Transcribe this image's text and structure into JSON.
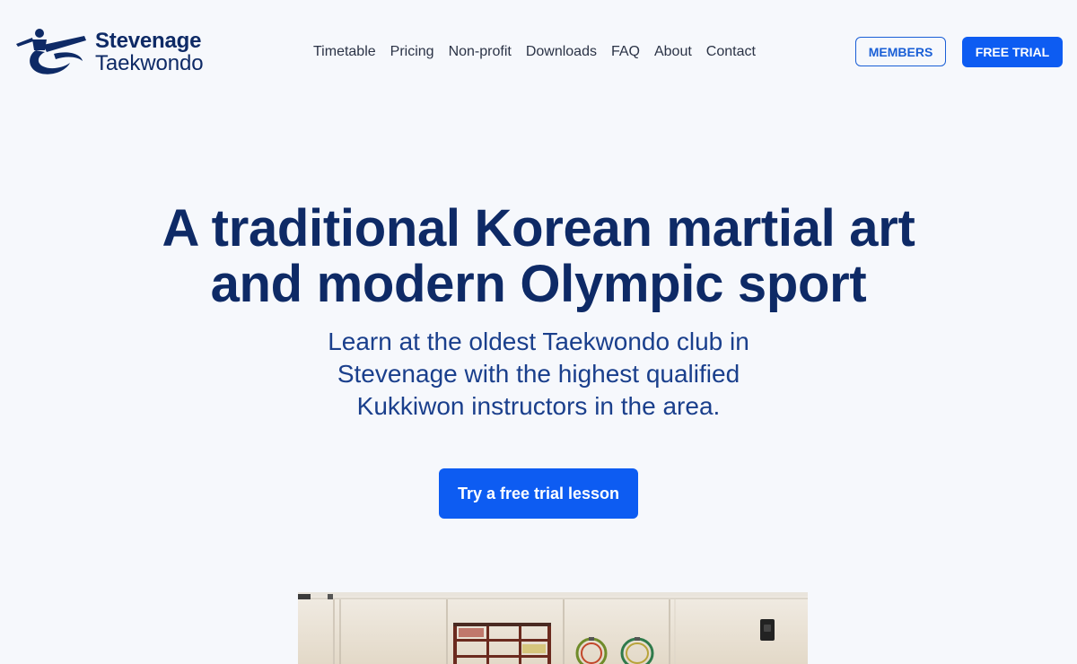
{
  "brand": {
    "line1": "Stevenage",
    "line2": "Taekwondo"
  },
  "nav": [
    {
      "label": "Timetable"
    },
    {
      "label": "Pricing"
    },
    {
      "label": "Non-profit"
    },
    {
      "label": "Downloads"
    },
    {
      "label": "FAQ"
    },
    {
      "label": "About"
    },
    {
      "label": "Contact"
    }
  ],
  "header_buttons": {
    "members": "MEMBERS",
    "free_trial": "FREE TRIAL"
  },
  "hero": {
    "title_line1": "A traditional Korean martial art",
    "title_line2": "and modern Olympic sport",
    "sub_line1": "Learn at the oldest Taekwondo club in",
    "sub_line2": "Stevenage with the highest qualified",
    "sub_line3": "Kukkiwon instructors in the area.",
    "cta": "Try a free trial lesson"
  },
  "colors": {
    "brand_navy": "#0e2a66",
    "accent_blue": "#0d5cf2",
    "background": "#f6f8fc"
  },
  "icons": {
    "logo": "kicking-figure-logo-icon"
  }
}
